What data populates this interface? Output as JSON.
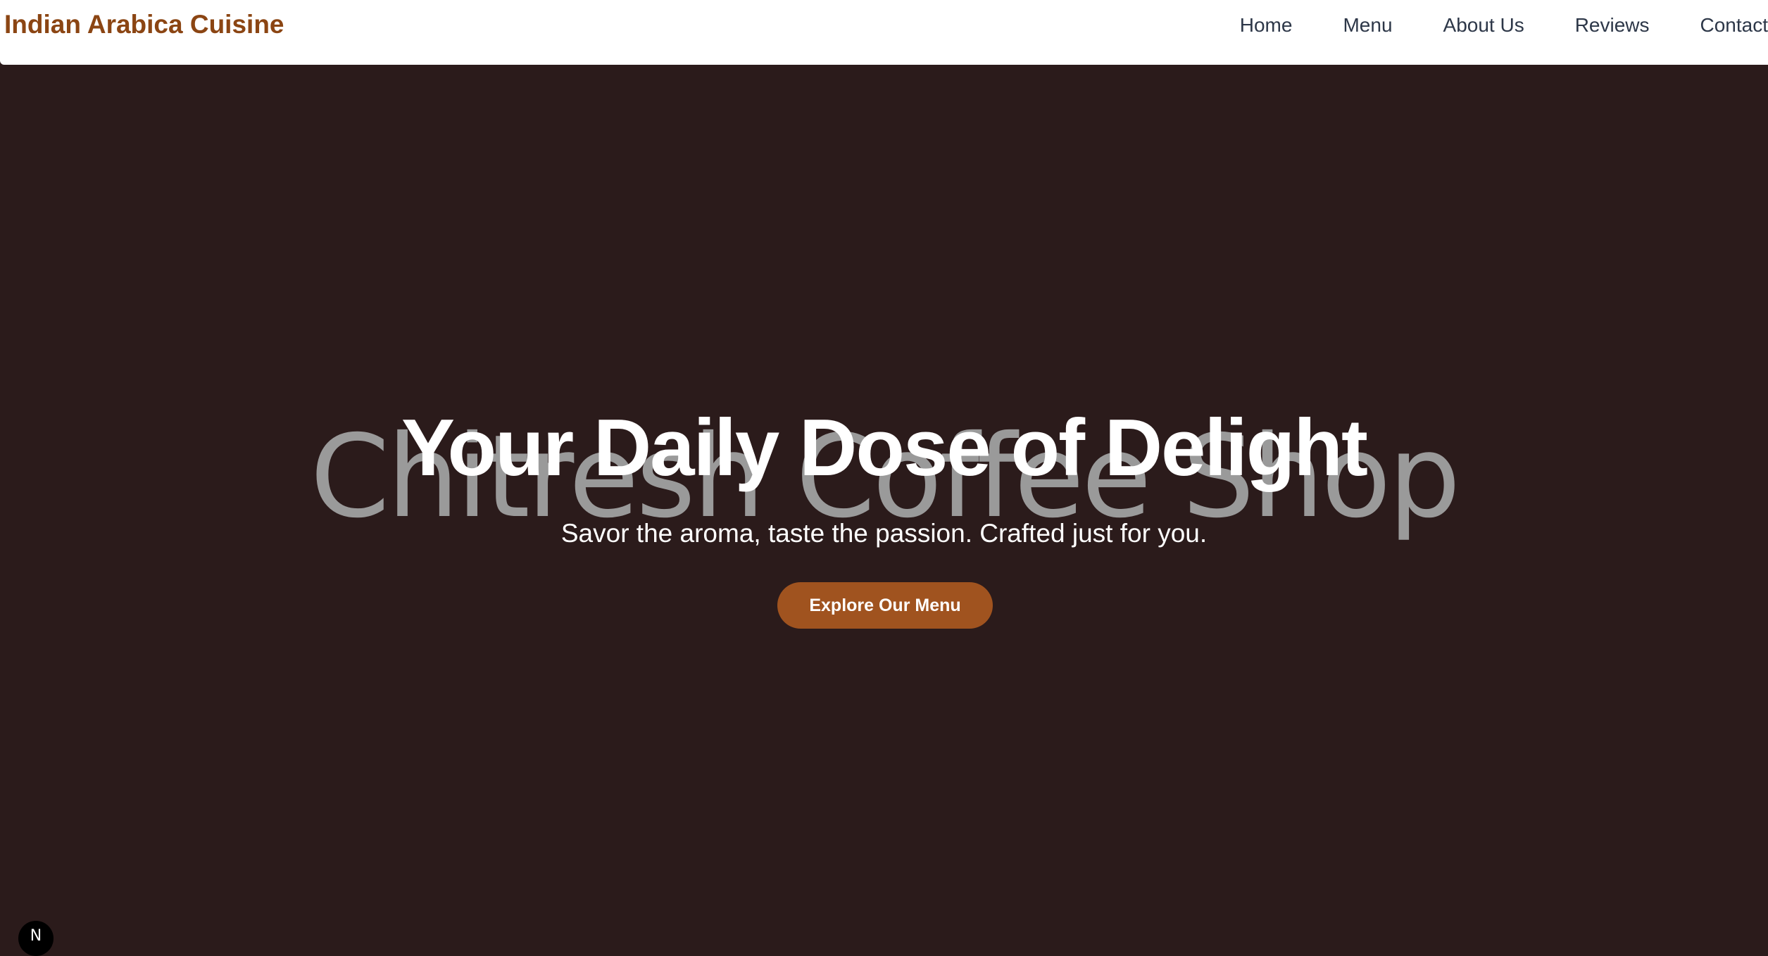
{
  "header": {
    "brand": "Indian Arabica Cuisine",
    "nav": [
      {
        "label": "Home"
      },
      {
        "label": "Menu"
      },
      {
        "label": "About Us"
      },
      {
        "label": "Reviews"
      },
      {
        "label": "Contact"
      }
    ]
  },
  "hero": {
    "background_text": "Chitresh Coffee Shop",
    "title": "Your Daily Dose of Delight",
    "subtitle": "Savor the aroma, taste the passion. Crafted just for you.",
    "cta_label": "Explore Our Menu"
  },
  "corner_badge": {
    "label": "N"
  },
  "colors": {
    "brand": "#8b4513",
    "hero_background": "#2b1b1b",
    "cta_background": "#a0531f",
    "nav_text": "#2d3748"
  }
}
